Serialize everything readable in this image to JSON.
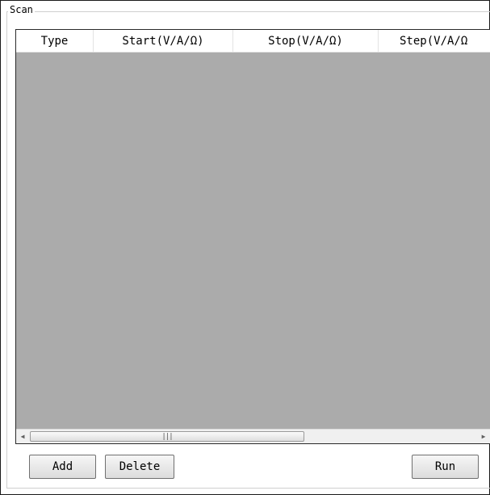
{
  "group": {
    "title": "Scan"
  },
  "table": {
    "columns": [
      "Type",
      "Start(V/A/Ω)",
      "Stop(V/A/Ω)",
      "Step(V/A/Ω"
    ],
    "rows": []
  },
  "scrollbar": {
    "left_arrow": "◀",
    "right_arrow": "▶",
    "grip": "|||"
  },
  "buttons": {
    "add": "Add",
    "delete": "Delete",
    "run": "Run"
  }
}
